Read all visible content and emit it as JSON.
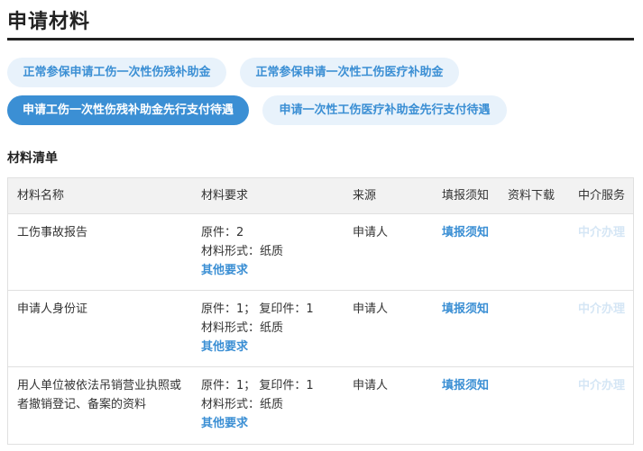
{
  "page": {
    "title": "申请材料"
  },
  "tabs": [
    {
      "label": "正常参保申请工伤一次性伤残补助金",
      "active": false
    },
    {
      "label": "正常参保申请一次性工伤医疗补助金",
      "active": false
    },
    {
      "label": "申请工伤一次性伤残补助金先行支付待遇",
      "active": true
    },
    {
      "label": "申请一次性工伤医疗补助金先行支付待遇",
      "active": false
    }
  ],
  "section": {
    "title": "材料清单"
  },
  "table": {
    "headers": {
      "name": "材料名称",
      "requirement": "材料要求",
      "source": "来源",
      "fill_notice": "填报须知",
      "download": "资料下载",
      "agent": "中介服务"
    },
    "rows": [
      {
        "name": "工伤事故报告",
        "req_copies": "原件：2",
        "req_form": "材料形式：纸质",
        "req_other": "其他要求",
        "source": "申请人",
        "fill_notice": "填报须知",
        "agent": "中介办理"
      },
      {
        "name": "申请人身份证",
        "req_copies": "原件：1； 复印件：1",
        "req_form": "材料形式：纸质",
        "req_other": "其他要求",
        "source": "申请人",
        "fill_notice": "填报须知",
        "agent": "中介办理"
      },
      {
        "name": "用人单位被依法吊销营业执照或者撤销登记、备案的资料",
        "req_copies": "原件：1； 复印件：1",
        "req_form": "材料形式：纸质",
        "req_other": "其他要求",
        "source": "申请人",
        "fill_notice": "填报须知",
        "agent": "中介办理"
      }
    ]
  },
  "colors": {
    "accent": "#3b8fd4",
    "tab_inactive_bg": "#e8f2fb",
    "disabled_link": "#d5e6f5",
    "header_bg": "#f2f2f2"
  }
}
